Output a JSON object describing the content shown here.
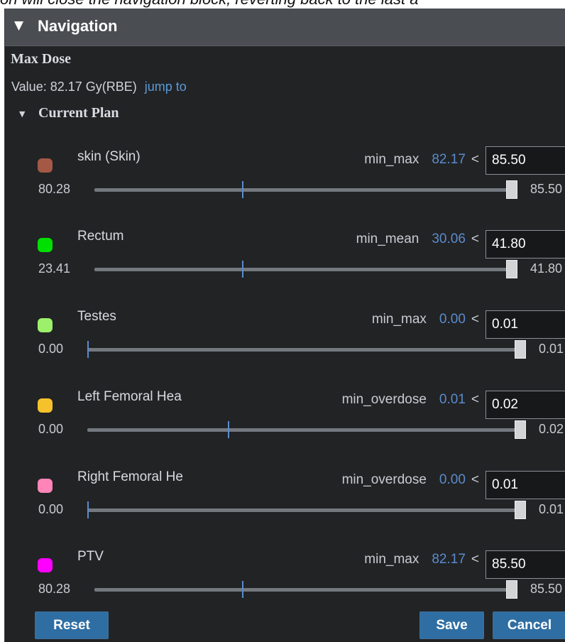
{
  "caption": "on will close the navigation block, reverting back to the last a",
  "navigation": {
    "title": "Navigation",
    "section_title": "Max Dose",
    "value_label": "Value:",
    "value": "82.17 Gy(RBE)",
    "jump_link": "jump to",
    "plan_label": "Current Plan"
  },
  "icons": {
    "collapse": "triangle-down-icon",
    "plan_toggle": "small-triangle-down-icon"
  },
  "structures": [
    {
      "name": "skin (Skin)",
      "color": "#a45846",
      "objective": "min_max",
      "current": "82.17",
      "comparator": "<",
      "threshold": "85.50",
      "range_min": "80.28",
      "range_max": "85.50",
      "marker_fraction": 0.36,
      "handle_fraction": 1.0
    },
    {
      "name": "Rectum",
      "color": "#00e000",
      "objective": "min_mean",
      "current": "30.06",
      "comparator": "<",
      "threshold": "41.80",
      "range_min": "23.41",
      "range_max": "41.80",
      "marker_fraction": 0.36,
      "handle_fraction": 1.0
    },
    {
      "name": "Testes",
      "color": "#9cf06a",
      "objective": "min_max",
      "current": "0.00",
      "comparator": "<",
      "threshold": "0.01",
      "range_min": "0.00",
      "range_max": "0.01",
      "marker_fraction": 0.0,
      "handle_fraction": 1.0
    },
    {
      "name": "Left Femoral Hea",
      "color": "#f5c22b",
      "objective": "min_overdose",
      "current": "0.01",
      "comparator": "<",
      "threshold": "0.02",
      "range_min": "0.00",
      "range_max": "0.02",
      "marker_fraction": 0.33,
      "handle_fraction": 1.0
    },
    {
      "name": "Right Femoral He",
      "color": "#ff85b8",
      "objective": "min_overdose",
      "current": "0.00",
      "comparator": "<",
      "threshold": "0.01",
      "range_min": "0.00",
      "range_max": "0.01",
      "marker_fraction": 0.0,
      "handle_fraction": 1.0
    },
    {
      "name": "PTV",
      "color": "#ff00ff",
      "objective": "min_max",
      "current": "82.17",
      "comparator": "<",
      "threshold": "85.50",
      "range_min": "80.28",
      "range_max": "85.50",
      "marker_fraction": 0.36,
      "handle_fraction": 1.0
    }
  ],
  "buttons": {
    "reset": "Reset",
    "save": "Save",
    "cancel": "Cancel"
  },
  "colors": {
    "panel_bg": "#222325",
    "header_bg": "#4a4d52",
    "accent_blue": "#5a8ccc",
    "button_blue": "#2f6ea3"
  }
}
